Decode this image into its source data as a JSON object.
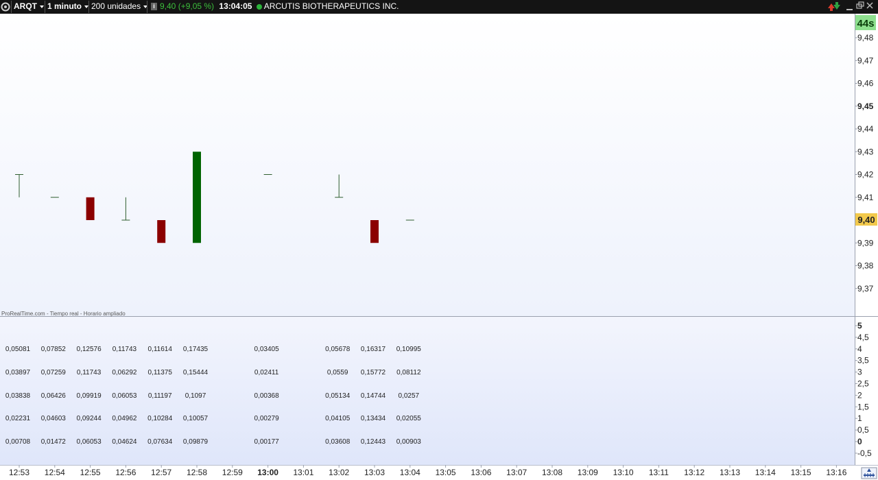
{
  "toolbar": {
    "symbol": "ARQT",
    "timeframe": "1 minuto",
    "units": "200 unidades",
    "info_icon": "i",
    "price_change": "9,40 (+9,05 %)",
    "time": "13:04:05",
    "instrument_name": "ARCUTIS BIOTHERAPEUTICS INC.",
    "icons": [
      "settings-icon",
      "info-icon",
      "status-dot-icon",
      "refresh-icon",
      "minimize-icon",
      "restore-icon",
      "close-icon"
    ],
    "colors": {
      "background": "#141414",
      "price_change": "#3cbf3c",
      "status_dot": "#2bb33a"
    }
  },
  "chart_data": [
    {
      "type": "candlestick",
      "source_text": "ProRealTime.com - Tiempo real - Horario ampliado",
      "countdown": "44s",
      "last_price": 9.4,
      "last_price_label": "9,40",
      "y_ticks": [
        "9,48",
        "9,47",
        "9,46",
        "9,45",
        "9,44",
        "9,43",
        "9,42",
        "9,41",
        "9,40",
        "9,39",
        "9,38",
        "9,37"
      ],
      "y_bold_ticks": [
        "9,45"
      ],
      "x_ticks": [
        "12:53",
        "12:54",
        "12:55",
        "12:56",
        "12:57",
        "12:58",
        "12:59",
        "13:00",
        "13:01",
        "13:02",
        "13:03",
        "13:04",
        "13:05",
        "13:06",
        "13:07",
        "13:08",
        "13:09",
        "13:10",
        "13:11",
        "13:12",
        "13:13",
        "13:14",
        "13:15",
        "13:16"
      ],
      "x_bold_ticks": [
        "13:00"
      ],
      "candles": [
        {
          "time": "12:53",
          "open": 9.42,
          "high": 9.42,
          "low": 9.41,
          "close": 9.42
        },
        {
          "time": "12:54",
          "open": 9.41,
          "high": 9.41,
          "low": 9.41,
          "close": 9.41
        },
        {
          "time": "12:55",
          "open": 9.41,
          "high": 9.41,
          "low": 9.4,
          "close": 9.4
        },
        {
          "time": "12:56",
          "open": 9.4,
          "high": 9.41,
          "low": 9.4,
          "close": 9.4
        },
        {
          "time": "12:57",
          "open": 9.4,
          "high": 9.4,
          "low": 9.39,
          "close": 9.39
        },
        {
          "time": "12:58",
          "open": 9.39,
          "high": 9.43,
          "low": 9.39,
          "close": 9.43
        },
        {
          "time": "13:00",
          "open": 9.42,
          "high": 9.42,
          "low": 9.42,
          "close": 9.42
        },
        {
          "time": "13:02",
          "open": 9.41,
          "high": 9.42,
          "low": 9.41,
          "close": 9.41
        },
        {
          "time": "13:03",
          "open": 9.4,
          "high": 9.4,
          "low": 9.39,
          "close": 9.39
        },
        {
          "time": "13:04",
          "open": 9.4,
          "high": 9.4,
          "low": 9.4,
          "close": 9.4
        }
      ],
      "colors": {
        "up": "#006400",
        "down": "#8b0000",
        "doji": "#2e5e2e",
        "background": "#f7f8fe",
        "last_price_bg": "#f2c94c",
        "countdown_bg": "#8ee08e"
      }
    },
    {
      "type": "table",
      "y_ticks": [
        "5",
        "4,5",
        "4",
        "3,5",
        "3",
        "2,5",
        "2",
        "1,5",
        "1",
        "0,5",
        "0",
        "-0,5"
      ],
      "y_bold_ticks": [
        "5",
        "0"
      ],
      "columns": [
        "12:53",
        "12:54",
        "12:55",
        "12:56",
        "12:57",
        "12:58",
        "13:00",
        "13:02",
        "13:03",
        "13:04"
      ],
      "rows": [
        [
          "0,05081",
          "0,07852",
          "0,12576",
          "0,11743",
          "0,11614",
          "0,17435",
          "0,03405",
          "0,05678",
          "0,16317",
          "0,10995"
        ],
        [
          "0,03897",
          "0,07259",
          "0,11743",
          "0,06292",
          "0,11375",
          "0,15444",
          "0,02411",
          "0,0559",
          "0,15772",
          "0,08112"
        ],
        [
          "0,03838",
          "0,06426",
          "0,09919",
          "0,06053",
          "0,11197",
          "0,1097",
          "0,00368",
          "0,05134",
          "0,14744",
          "0,0257"
        ],
        [
          "0,02231",
          "0,04603",
          "0,09244",
          "0,04962",
          "0,10284",
          "0,10057",
          "0,00279",
          "0,04105",
          "0,13434",
          "0,02055"
        ],
        [
          "0,00708",
          "0,01472",
          "0,06053",
          "0,04624",
          "0,07634",
          "0,09879",
          "0,00177",
          "0,03608",
          "0,12443",
          "0,00903"
        ]
      ],
      "colors": {
        "background": "#e8edfb"
      }
    }
  ]
}
